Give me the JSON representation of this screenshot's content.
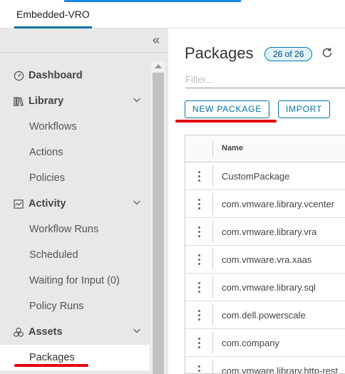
{
  "topbar": {
    "tab_label": "Embedded-VRO"
  },
  "sidebar": {
    "items": [
      {
        "label": "Dashboard",
        "type": "section",
        "icon": "dashboard-icon",
        "chevron": false
      },
      {
        "label": "Library",
        "type": "section",
        "icon": "library-icon",
        "chevron": true
      },
      {
        "label": "Workflows",
        "type": "sub"
      },
      {
        "label": "Actions",
        "type": "sub"
      },
      {
        "label": "Policies",
        "type": "sub"
      },
      {
        "label": "Activity",
        "type": "section",
        "icon": "activity-icon",
        "chevron": true
      },
      {
        "label": "Workflow Runs",
        "type": "sub"
      },
      {
        "label": "Scheduled",
        "type": "sub"
      },
      {
        "label": "Waiting for Input (0)",
        "type": "sub"
      },
      {
        "label": "Policy Runs",
        "type": "sub"
      },
      {
        "label": "Assets",
        "type": "section",
        "icon": "assets-icon",
        "chevron": true
      },
      {
        "label": "Packages",
        "type": "sub",
        "active": true
      }
    ]
  },
  "main": {
    "title": "Packages",
    "count_badge": "26 of 26",
    "filter_placeholder": "Filter...",
    "new_package_label": "NEW PACKAGE",
    "import_label": "IMPORT",
    "column_name": "Name",
    "rows": [
      "CustomPackage",
      "com.vmware.library.vcenter",
      "com.vmware.library.vra",
      "com.vmware.vra.xaas",
      "com.vmware.library.sql",
      "com.dell.powerscale",
      "com.company",
      "com.vmware.library.http-rest"
    ]
  },
  "colors": {
    "accent": "#0072a3",
    "annotation": "#e3000f",
    "sidebar_bg": "#e8e8e8"
  }
}
